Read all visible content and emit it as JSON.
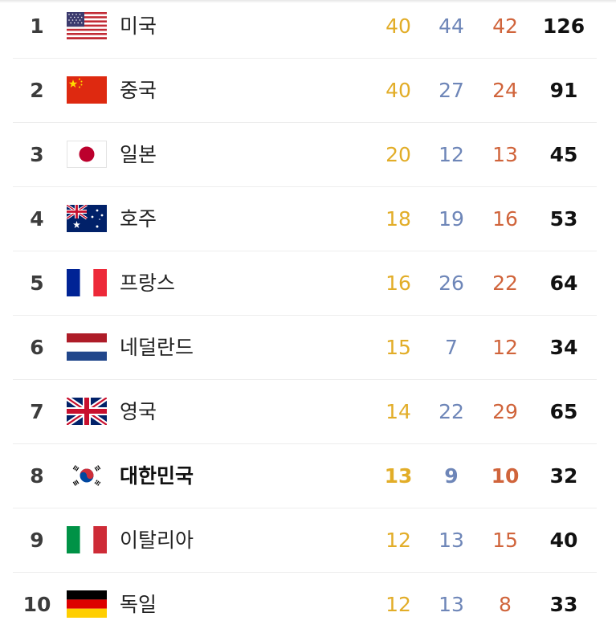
{
  "medal_table": {
    "rows": [
      {
        "rank": "1",
        "country": "미국",
        "gold": "40",
        "silver": "44",
        "bronze": "42",
        "total": "126",
        "flag": "usa-flag-icon"
      },
      {
        "rank": "2",
        "country": "중국",
        "gold": "40",
        "silver": "27",
        "bronze": "24",
        "total": "91",
        "flag": "china-flag-icon"
      },
      {
        "rank": "3",
        "country": "일본",
        "gold": "20",
        "silver": "12",
        "bronze": "13",
        "total": "45",
        "flag": "japan-flag-icon"
      },
      {
        "rank": "4",
        "country": "호주",
        "gold": "18",
        "silver": "19",
        "bronze": "16",
        "total": "53",
        "flag": "australia-flag-icon"
      },
      {
        "rank": "5",
        "country": "프랑스",
        "gold": "16",
        "silver": "26",
        "bronze": "22",
        "total": "64",
        "flag": "france-flag-icon"
      },
      {
        "rank": "6",
        "country": "네덜란드",
        "gold": "15",
        "silver": "7",
        "bronze": "12",
        "total": "34",
        "flag": "netherlands-flag-icon"
      },
      {
        "rank": "7",
        "country": "영국",
        "gold": "14",
        "silver": "22",
        "bronze": "29",
        "total": "65",
        "flag": "uk-flag-icon"
      },
      {
        "rank": "8",
        "country": "대한민국",
        "gold": "13",
        "silver": "9",
        "bronze": "10",
        "total": "32",
        "flag": "korea-flag-icon",
        "highlighted": true
      },
      {
        "rank": "9",
        "country": "이탈리아",
        "gold": "12",
        "silver": "13",
        "bronze": "15",
        "total": "40",
        "flag": "italy-flag-icon"
      },
      {
        "rank": "10",
        "country": "독일",
        "gold": "12",
        "silver": "13",
        "bronze": "8",
        "total": "33",
        "flag": "germany-flag-icon"
      }
    ]
  },
  "colors": {
    "gold": "#e2ad28",
    "silver": "#6e86b8",
    "bronze": "#d0643b",
    "divider": "#ededed"
  }
}
